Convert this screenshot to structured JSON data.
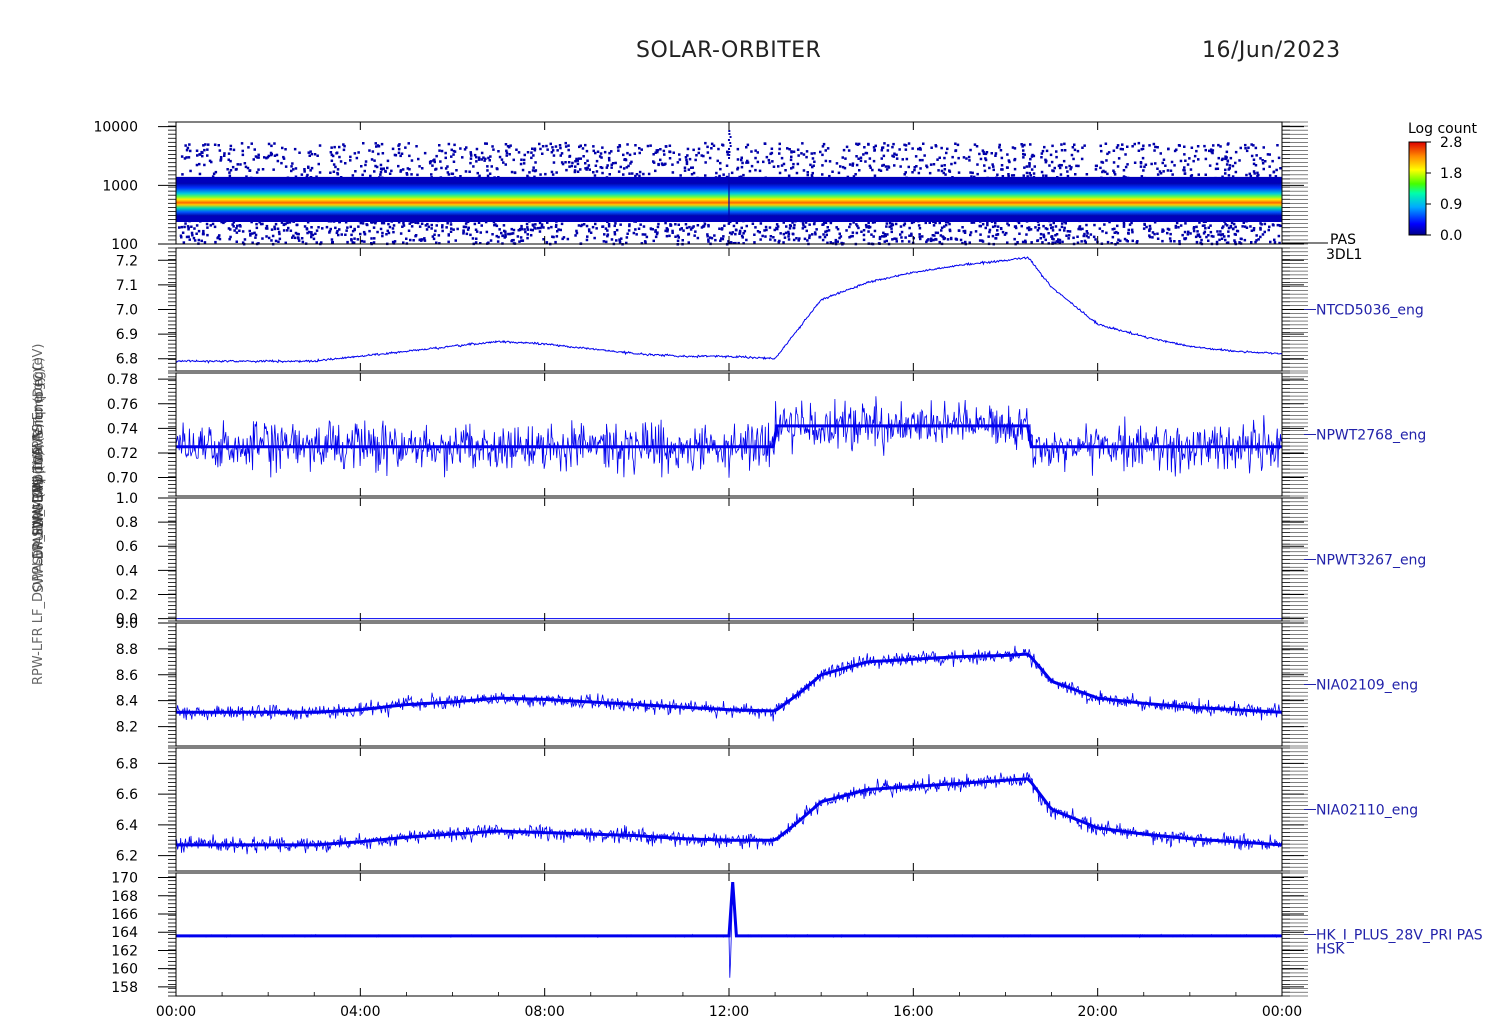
{
  "header": {
    "title": "SOLAR-ORBITER",
    "date": "16/Jun/2023"
  },
  "colors": {
    "trace": "#0000ee",
    "axis": "#000000",
    "label": "#2222aa"
  },
  "x_axis": {
    "ticks": [
      "00:00",
      "04:00",
      "08:00",
      "12:00",
      "16:00",
      "20:00",
      "00:00"
    ]
  },
  "y_axis_labels": [
    "PAS Energy (eV)",
    "Approx Temp (DegC)",
    "SWA-EAS TOPVS Temp (C)",
    "SWA-DPU 1V5 (V)",
    "SWA-DPU 3V3 (V)",
    "SWA-DPU 2V5 (V)",
    "RPW-LFR LF_DOPPLER_HV_MON (mA)"
  ],
  "colorbar": {
    "title": "Log count",
    "ticks": [
      "2.8",
      "1.8",
      "0.9",
      "0.0"
    ],
    "sub_labels": [
      "PAS",
      "3DL1"
    ]
  },
  "chart_data": [
    {
      "type": "heatmap",
      "panel_label": "",
      "ylim": [
        100,
        12000
      ],
      "log_y": true,
      "y_ticks": [
        "10000",
        "1000",
        "100"
      ],
      "energy_band_center_eV": 550,
      "energy_band_range_eV": [
        300,
        1100
      ],
      "max_log_count": 2.8,
      "spike_time_hr": 12.0
    },
    {
      "type": "line",
      "panel_label": "NTCD5036_eng",
      "ylim": [
        6.75,
        7.25
      ],
      "y_ticks": [
        "7.2",
        "7.1",
        "7.0",
        "6.9",
        "6.8"
      ],
      "noise": 0.004,
      "x": [
        0,
        1,
        2,
        3,
        4,
        5,
        6,
        7,
        8,
        9,
        10,
        11,
        12,
        13,
        13.5,
        14,
        15,
        16,
        17,
        18,
        18.5,
        19,
        20,
        21,
        22,
        23,
        24
      ],
      "y": [
        6.79,
        6.79,
        6.79,
        6.79,
        6.81,
        6.83,
        6.85,
        6.87,
        6.86,
        6.84,
        6.82,
        6.81,
        6.81,
        6.8,
        6.92,
        7.04,
        7.11,
        7.15,
        7.18,
        7.2,
        7.21,
        7.09,
        6.94,
        6.89,
        6.85,
        6.83,
        6.82
      ]
    },
    {
      "type": "line",
      "panel_label": "NPWT2768_eng",
      "ylim": [
        0.685,
        0.785
      ],
      "y_ticks": [
        "0.78",
        "0.76",
        "0.74",
        "0.72",
        "0.70"
      ],
      "noise": 0.018,
      "x": [
        0,
        12.99,
        13.0,
        18.54,
        18.55,
        24
      ],
      "y": [
        0.725,
        0.725,
        0.742,
        0.742,
        0.725,
        0.725
      ]
    },
    {
      "type": "line",
      "panel_label": "NPWT3267_eng",
      "ylim": [
        -0.02,
        1.0
      ],
      "y_ticks": [
        "1.0",
        "0.8",
        "0.6",
        "0.4",
        "0.2",
        "0.0"
      ],
      "noise": 0.0,
      "x": [
        0,
        24
      ],
      "y": [
        0.0,
        0.0
      ]
    },
    {
      "type": "line",
      "panel_label": "NIA02109_eng",
      "ylim": [
        8.05,
        9.0
      ],
      "y_ticks": [
        "9.0",
        "8.8",
        "8.6",
        "8.4",
        "8.2"
      ],
      "noise": 0.055,
      "x": [
        0,
        3,
        4,
        5,
        6,
        7,
        8,
        9,
        10,
        11,
        12,
        13,
        13.5,
        14,
        15,
        16,
        17,
        18,
        18.5,
        19,
        20,
        21,
        22,
        23,
        24
      ],
      "y": [
        8.31,
        8.31,
        8.33,
        8.37,
        8.39,
        8.42,
        8.41,
        8.39,
        8.37,
        8.35,
        8.33,
        8.32,
        8.45,
        8.6,
        8.7,
        8.72,
        8.74,
        8.75,
        8.76,
        8.55,
        8.42,
        8.38,
        8.35,
        8.33,
        8.31
      ]
    },
    {
      "type": "line",
      "panel_label": "NIA02110_eng",
      "ylim": [
        6.1,
        6.9
      ],
      "y_ticks": [
        "6.8",
        "6.6",
        "6.4",
        "6.2"
      ],
      "noise": 0.05,
      "x": [
        0,
        3,
        4,
        5,
        6,
        7,
        8,
        9,
        10,
        11,
        12,
        13,
        13.5,
        14,
        15,
        16,
        17,
        18,
        18.5,
        19,
        20,
        21,
        22,
        23,
        24
      ],
      "y": [
        6.27,
        6.27,
        6.29,
        6.32,
        6.34,
        6.36,
        6.35,
        6.34,
        6.33,
        6.31,
        6.3,
        6.3,
        6.42,
        6.55,
        6.63,
        6.65,
        6.67,
        6.69,
        6.7,
        6.5,
        6.38,
        6.34,
        6.31,
        6.29,
        6.27
      ]
    },
    {
      "type": "line",
      "panel_label": "HK_I_PLUS_28V_PRI PAS HSK",
      "ylim": [
        157.0,
        170.5
      ],
      "y_ticks": [
        "170",
        "168",
        "166",
        "164",
        "162",
        "160",
        "158"
      ],
      "noise": 0.1,
      "x": [
        0,
        12.0,
        12.02,
        12.08,
        12.14,
        12.2,
        24
      ],
      "y": [
        163.6,
        163.6,
        158.2,
        169.5,
        163.6,
        163.6,
        163.6
      ]
    }
  ]
}
